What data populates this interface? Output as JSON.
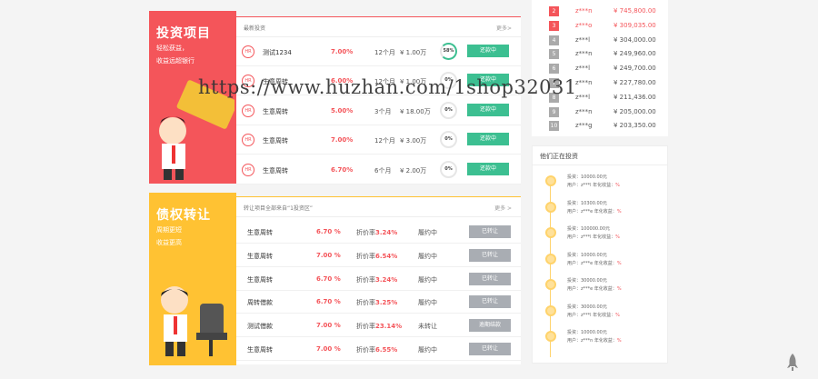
{
  "invest_promo": {
    "title": "投资项目",
    "lines": [
      "轻松获益，",
      "收益远超银行"
    ]
  },
  "transfer_promo": {
    "title": "债权转让",
    "lines": [
      "周期更短",
      "收益更高"
    ]
  },
  "invest_panel": {
    "title": "最新投资",
    "more": "更多>",
    "rows": [
      {
        "badge": "HR",
        "name": "测试1234",
        "rate": "7.00%",
        "term": "12个月",
        "amount": "¥ 1.00万",
        "progress": "58%",
        "progress_value": 0.58,
        "button": "还款中"
      },
      {
        "badge": "HR",
        "name": "生意周转",
        "rate": "6.00%",
        "term": "12个月",
        "amount": "¥ 1.00万",
        "progress": "0%",
        "progress_value": 0,
        "button": "还款中"
      },
      {
        "badge": "HR",
        "name": "生意周转",
        "rate": "5.00%",
        "term": "3个月",
        "amount": "¥ 18.00万",
        "progress": "0%",
        "progress_value": 0,
        "button": "还款中"
      },
      {
        "badge": "HR",
        "name": "生意周转",
        "rate": "7.00%",
        "term": "12个月",
        "amount": "¥ 3.00万",
        "progress": "0%",
        "progress_value": 0,
        "button": "还款中"
      },
      {
        "badge": "HR",
        "name": "生意周转",
        "rate": "6.70%",
        "term": "6个月",
        "amount": "¥ 2.00万",
        "progress": "0%",
        "progress_value": 0,
        "button": "还款中"
      }
    ]
  },
  "transfer_panel": {
    "title": "转让项目全部来自“1投资区”",
    "more": "更多 >",
    "rows": [
      {
        "name": "生意周转",
        "rate": "6.70 %",
        "disc_label": "折价率",
        "disc": "3.24%",
        "status": "履约中",
        "button": "已转让"
      },
      {
        "name": "生意周转",
        "rate": "7.00 %",
        "disc_label": "折价率",
        "disc": "6.54%",
        "status": "履约中",
        "button": "已转让"
      },
      {
        "name": "生意周转",
        "rate": "6.70 %",
        "disc_label": "折价率",
        "disc": "3.24%",
        "status": "履约中",
        "button": "已转让"
      },
      {
        "name": "周转借款",
        "rate": "6.70 %",
        "disc_label": "折价率",
        "disc": "3.25%",
        "status": "履约中",
        "button": "已转让"
      },
      {
        "name": "测试借款",
        "rate": "7.00 %",
        "disc_label": "折价率",
        "disc": "23.14%",
        "status": "未转让",
        "button": "逾期结款"
      },
      {
        "name": "生意周转",
        "rate": "7.00 %",
        "disc_label": "折价率",
        "disc": "6.55%",
        "status": "履约中",
        "button": "已转让"
      }
    ]
  },
  "ranking": [
    {
      "rank": "2",
      "user": "z***n",
      "amount": "¥ 745,800.00",
      "highlight": true
    },
    {
      "rank": "3",
      "user": "z***o",
      "amount": "¥ 309,035.00",
      "highlight": true
    },
    {
      "rank": "4",
      "user": "z***l",
      "amount": "¥ 304,000.00",
      "highlight": false
    },
    {
      "rank": "5",
      "user": "z***n",
      "amount": "¥ 249,960.00",
      "highlight": false
    },
    {
      "rank": "6",
      "user": "z***l",
      "amount": "¥ 249,700.00",
      "highlight": false
    },
    {
      "rank": "7",
      "user": "z***n",
      "amount": "¥ 227,780.00",
      "highlight": false
    },
    {
      "rank": "8",
      "user": "z***l",
      "amount": "¥ 211,436.00",
      "highlight": false
    },
    {
      "rank": "9",
      "user": "z***n",
      "amount": "¥ 205,000.00",
      "highlight": false
    },
    {
      "rank": "10",
      "user": "z***g",
      "amount": "¥ 203,350.00",
      "highlight": false
    }
  ],
  "feed": {
    "title": "他们正在投资",
    "items": [
      {
        "invest": "投资：10000.00元",
        "user": "用户：z***l",
        "rate_label": "年化收益：",
        "pct": "%"
      },
      {
        "invest": "投资：10300.00元",
        "user": "用户：z***e",
        "rate_label": "年化收益：",
        "pct": "%"
      },
      {
        "invest": "投资：100000.00元",
        "user": "用户：z***l",
        "rate_label": "年化收益：",
        "pct": "%"
      },
      {
        "invest": "投资：10000.00元",
        "user": "用户：z***e",
        "rate_label": "年化收益：",
        "pct": "%"
      },
      {
        "invest": "投资：30000.00元",
        "user": "用户：z***e",
        "rate_label": "年化收益：",
        "pct": "%"
      },
      {
        "invest": "投资：30000.00元",
        "user": "用户：z***l",
        "rate_label": "年化收益：",
        "pct": "%"
      },
      {
        "invest": "投资：10000.00元",
        "user": "用户：z***n",
        "rate_label": "年化收益：",
        "pct": "%"
      }
    ]
  },
  "watermark": "https://www.huzhan.com/1shop32031",
  "colors": {
    "red": "#f4555a",
    "yellow": "#ffc233",
    "green": "#3cbf91",
    "gray_button": "#a9adb3"
  }
}
